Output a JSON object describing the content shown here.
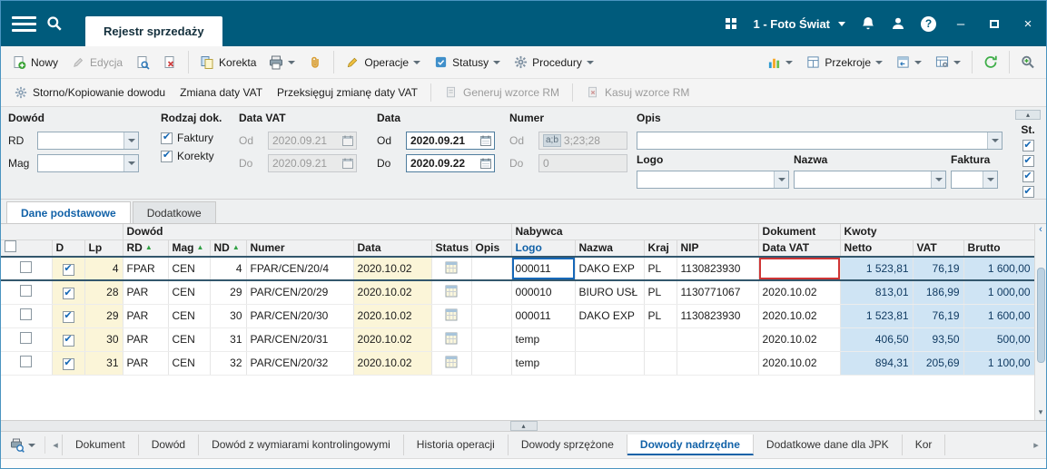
{
  "icons": {
    "check": "✔",
    "sort_asc": "▲",
    "minimize": "–",
    "close": "×",
    "help": "?",
    "chevron_left_small": "‹",
    "chevron_right_small": "›",
    "scroll_left": "◂",
    "scroll_right": "▸",
    "collapse_up": "▴",
    "scroll_down": "▾"
  },
  "titlebar": {
    "tab": "Rejestr sprzedaży",
    "company": "1 - Foto Świat"
  },
  "toolbar": {
    "nowy": "Nowy",
    "edycja": "Edycja",
    "korekta": "Korekta",
    "operacje": "Operacje",
    "statusy": "Statusy",
    "procedury": "Procedury",
    "przekroje": "Przekroje"
  },
  "toolbar2": {
    "storno": "Storno/Kopiowanie dowodu",
    "zmiana": "Zmiana daty VAT",
    "przeksieguj": "Przeksięguj zmianę daty VAT",
    "generuj": "Generuj wzorce RM",
    "kasuj": "Kasuj wzorce RM"
  },
  "filters": {
    "dowod_title": "Dowód",
    "rd_label": "RD",
    "mag_label": "Mag",
    "rodzaj_title": "Rodzaj dok.",
    "faktury_label": "Faktury",
    "korekty_label": "Korekty",
    "data_vat_title": "Data VAT",
    "data_title": "Data",
    "numer_title": "Numer",
    "opis_title": "Opis",
    "od_label": "Od",
    "do_label": "Do",
    "data_vat_od": "2020.09.21",
    "data_vat_do": "2020.09.21",
    "data_od": "2020.09.21",
    "data_do": "2020.09.22",
    "numer_od_badge": "a;b",
    "numer_od": "3;23;28",
    "numer_do": "0",
    "logo_label": "Logo",
    "nazwa_label": "Nazwa",
    "faktura_label": "Faktura",
    "st_label": "St."
  },
  "tabs": {
    "dane": "Dane podstawowe",
    "dodatkowe": "Dodatkowe"
  },
  "grid": {
    "groups": {
      "dowod": "Dowód",
      "nabywca": "Nabywca",
      "dokument": "Dokument",
      "kwoty": "Kwoty"
    },
    "columns": {
      "d": "D",
      "lp": "Lp",
      "rd": "RD",
      "mag": "Mag",
      "nd": "ND",
      "numer": "Numer",
      "data": "Data",
      "status": "Status",
      "opis": "Opis",
      "logo": "Logo",
      "nazwa": "Nazwa",
      "kraj": "Kraj",
      "nip": "NIP",
      "data_vat": "Data VAT",
      "netto": "Netto",
      "vat": "VAT",
      "brutto": "Brutto"
    },
    "rows": [
      {
        "lp": "4",
        "rd": "FPAR",
        "mag": "CEN",
        "nd": "4",
        "numer": "FPAR/CEN/20/4",
        "data": "2020.10.02",
        "logo": "000011",
        "nazwa": "DAKO EXP",
        "kraj": "PL",
        "nip": "1130823930",
        "data_vat": "",
        "netto": "1 523,81",
        "vat": "76,19",
        "brutto": "1 600,00"
      },
      {
        "lp": "28",
        "rd": "PAR",
        "mag": "CEN",
        "nd": "29",
        "numer": "PAR/CEN/20/29",
        "data": "2020.10.02",
        "logo": "000010",
        "nazwa": "BIURO USŁ",
        "kraj": "PL",
        "nip": "1130771067",
        "data_vat": "2020.10.02",
        "netto": "813,01",
        "vat": "186,99",
        "brutto": "1 000,00"
      },
      {
        "lp": "29",
        "rd": "PAR",
        "mag": "CEN",
        "nd": "30",
        "numer": "PAR/CEN/20/30",
        "data": "2020.10.02",
        "logo": "000011",
        "nazwa": "DAKO EXP",
        "kraj": "PL",
        "nip": "1130823930",
        "data_vat": "2020.10.02",
        "netto": "1 523,81",
        "vat": "76,19",
        "brutto": "1 600,00"
      },
      {
        "lp": "30",
        "rd": "PAR",
        "mag": "CEN",
        "nd": "31",
        "numer": "PAR/CEN/20/31",
        "data": "2020.10.02",
        "logo": "temp",
        "nazwa": "",
        "kraj": "",
        "nip": "",
        "data_vat": "2020.10.02",
        "netto": "406,50",
        "vat": "93,50",
        "brutto": "500,00"
      },
      {
        "lp": "31",
        "rd": "PAR",
        "mag": "CEN",
        "nd": "32",
        "numer": "PAR/CEN/20/32",
        "data": "2020.10.02",
        "logo": "temp",
        "nazwa": "",
        "kraj": "",
        "nip": "",
        "data_vat": "2020.10.02",
        "netto": "894,31",
        "vat": "205,69",
        "brutto": "1 100,00"
      }
    ]
  },
  "bottom_tabs": {
    "items": [
      "Dokument",
      "Dowód",
      "Dowód z wymiarami kontrolingowymi",
      "Historia operacji",
      "Dowody sprzężone",
      "Dowody nadrzędne",
      "Dodatkowe dane dla JPK",
      "Kor"
    ],
    "active_index": 5
  }
}
